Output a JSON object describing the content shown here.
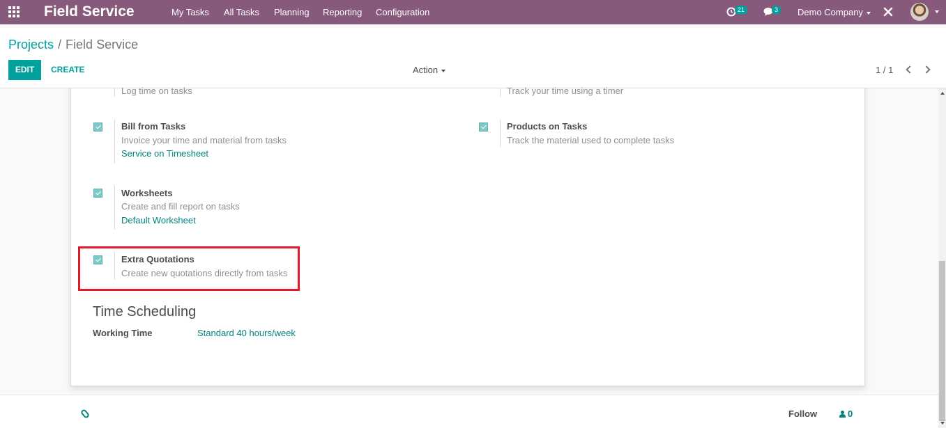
{
  "navbar": {
    "brand": "Field Service",
    "menu": [
      "My Tasks",
      "All Tasks",
      "Planning",
      "Reporting",
      "Configuration"
    ],
    "activity_count": "21",
    "messages_count": "3",
    "company": "Demo Company",
    "icons": [
      "apps-grid-icon",
      "clock-icon",
      "chat-icon",
      "debug-tools-icon",
      "avatar"
    ]
  },
  "control_panel": {
    "breadcrumb_parent": "Projects",
    "breadcrumb_sep": "/",
    "breadcrumb_current": "Field Service",
    "edit_label": "EDIT",
    "create_label": "CREATE",
    "action_label": "Action",
    "pager": "1 / 1"
  },
  "settings": {
    "log_time_desc": "Log time on tasks",
    "timer_desc": "Track your time using a timer",
    "bill_tasks": {
      "title": "Bill from Tasks",
      "desc": "Invoice your time and material from tasks",
      "link": "Service on Timesheet"
    },
    "products_tasks": {
      "title": "Products on Tasks",
      "desc": "Track the material used to complete tasks"
    },
    "worksheets": {
      "title": "Worksheets",
      "desc": "Create and fill report on tasks",
      "link": "Default Worksheet"
    },
    "extra_quotations": {
      "title": "Extra Quotations",
      "desc": "Create new quotations directly from tasks"
    }
  },
  "time_scheduling": {
    "section_title": "Time Scheduling",
    "working_time_label": "Working Time",
    "working_time_value": "Standard 40 hours/week"
  },
  "chatter": {
    "follow_label": "Follow",
    "followers_count": "0"
  },
  "colors": {
    "navbar": "#875a7b",
    "accent": "#00a09d",
    "highlight": "#e21b2b"
  }
}
